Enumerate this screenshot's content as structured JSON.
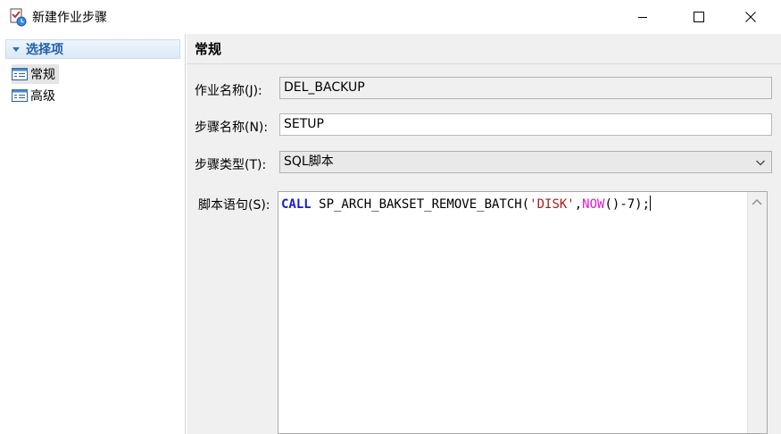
{
  "window": {
    "title": "新建作业步骤",
    "icon": "job-step-icon"
  },
  "sidebar": {
    "header": "选择项",
    "items": [
      {
        "label": "常规",
        "icon": "list-icon",
        "selected": true
      },
      {
        "label": "高级",
        "icon": "list-icon",
        "selected": false
      }
    ]
  },
  "main": {
    "section_title": "常规",
    "job_name": {
      "label": "作业名称(J):",
      "value": "DEL_BACKUP"
    },
    "step_name": {
      "label": "步骤名称(N):",
      "value": "SETUP"
    },
    "step_type": {
      "label": "步骤类型(T):",
      "value": "SQL脚本"
    },
    "script": {
      "label": "脚本语句(S):",
      "tokens": {
        "kw": "CALL",
        "proc": " SP_ARCH_BAKSET_REMOVE_BATCH(",
        "str": "'DISK'",
        "comma": ",",
        "fn": "NOW",
        "tail": "()-7);"
      }
    }
  },
  "colors": {
    "keyword": "#1b1bd2",
    "string": "#b11919",
    "function": "#e01ad6",
    "header_text": "#1e5fa8"
  }
}
